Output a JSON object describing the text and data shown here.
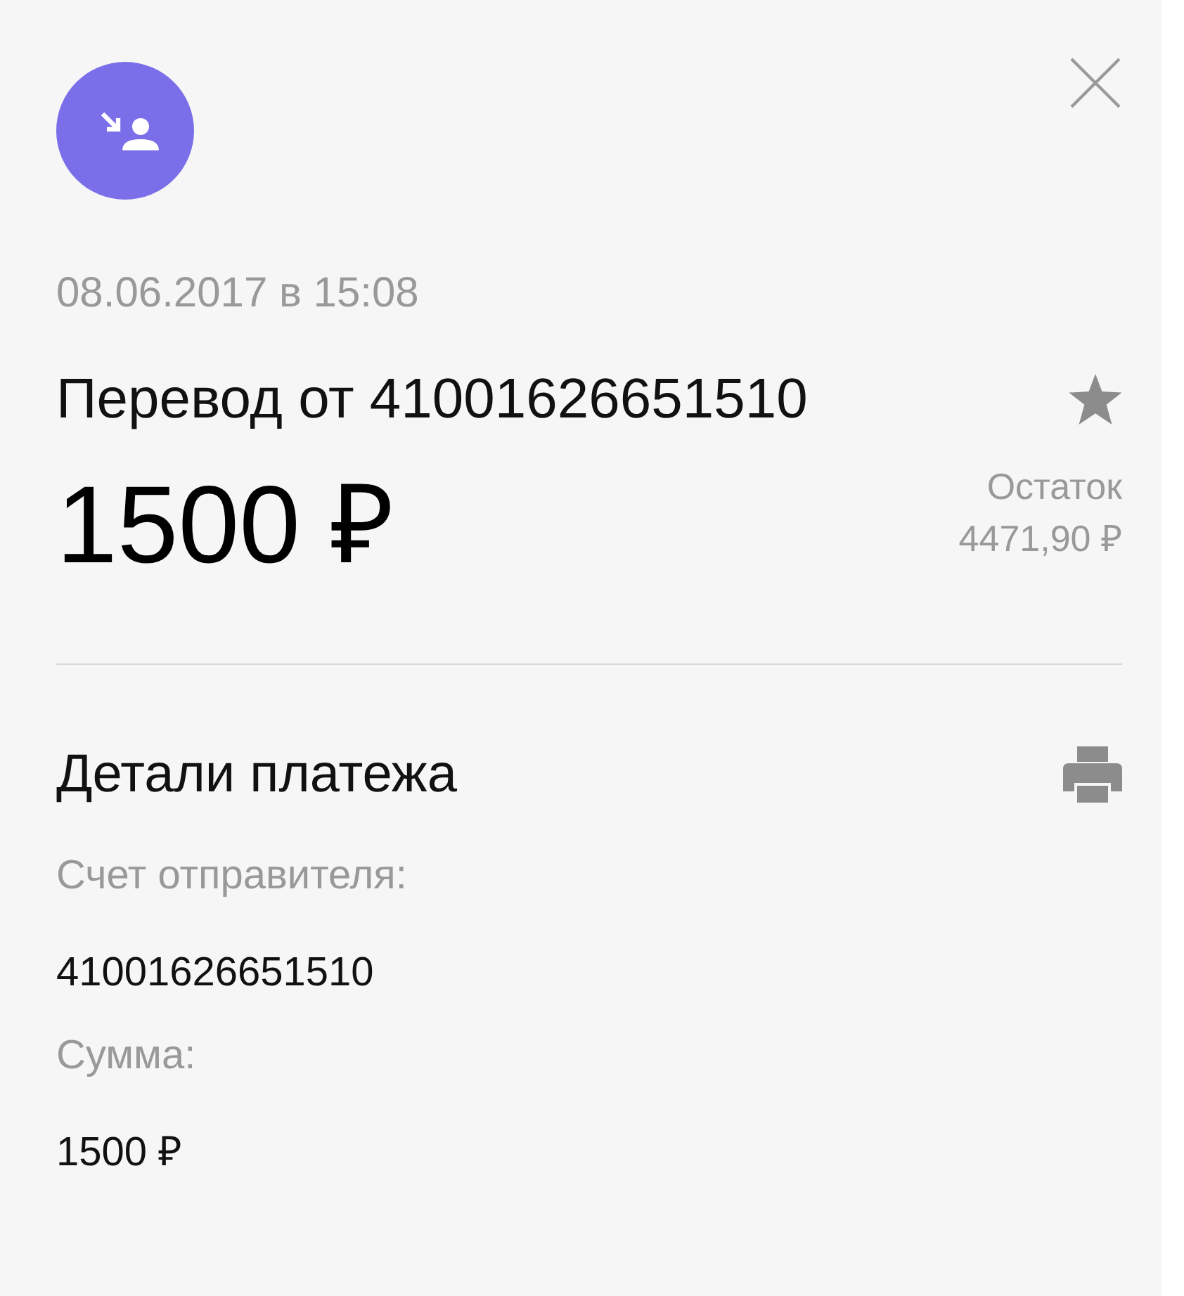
{
  "operation": {
    "date": "08.06.2017 в 15:08",
    "title": "Перевод от 41001626651510",
    "amount": "1500 ₽",
    "balance_label": "Остаток",
    "balance": "4471,90 ₽"
  },
  "details": {
    "title": "Детали платежа",
    "fields": [
      {
        "label": "Счет отправителя:",
        "value": "41001626651510"
      },
      {
        "label": "Сумма:",
        "value": "1500 ₽"
      }
    ]
  }
}
